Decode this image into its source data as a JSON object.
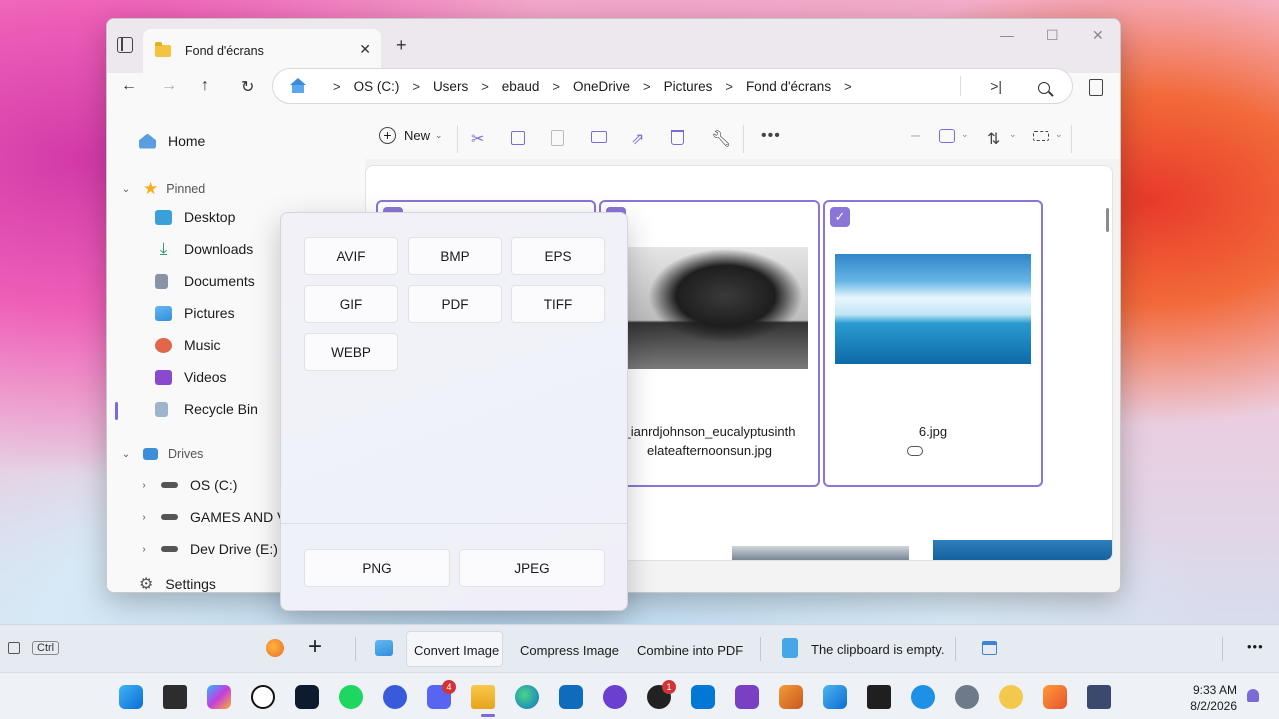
{
  "window": {
    "tab_title": "Fond d'écrans",
    "tab_close": "✕",
    "new_tab": "+",
    "min": "—",
    "max": "☐",
    "close": "✕"
  },
  "nav": {
    "back": "←",
    "forward": "→",
    "up": "↑",
    "refresh": "↻"
  },
  "address": {
    "crumbs": [
      "OS (C:)",
      "Users",
      "ebaud",
      "OneDrive",
      "Pictures",
      "Fond d'écrans"
    ],
    "separator": ">",
    "expand_glyph": ">|"
  },
  "sidebar": {
    "home": "Home",
    "pinned_header": "Pinned",
    "pinned": [
      {
        "label": "Desktop",
        "icon": "desktop-icon",
        "color": "#3aa0d8"
      },
      {
        "label": "Downloads",
        "icon": "download-icon",
        "color": "#2e9e6b"
      },
      {
        "label": "Documents",
        "icon": "documents-icon",
        "color": "#8a93a6"
      },
      {
        "label": "Pictures",
        "icon": "pictures-icon",
        "color": "#2f8fdc"
      },
      {
        "label": "Music",
        "icon": "music-icon",
        "color": "#e2664a"
      },
      {
        "label": "Videos",
        "icon": "videos-icon",
        "color": "#8a4ad0"
      },
      {
        "label": "Recycle Bin",
        "icon": "recycle-bin-icon",
        "color": "#6e8fb0"
      }
    ],
    "drives_header": "Drives",
    "drives": [
      {
        "label": "OS (C:)",
        "icon": "drive-icon"
      },
      {
        "label": "GAMES AND VS",
        "icon": "drive-icon"
      },
      {
        "label": "Dev Drive (E:)",
        "icon": "drive-icon"
      }
    ],
    "settings": "Settings",
    "active_color": "#7c6bd6"
  },
  "commandbar": {
    "new_label": "New",
    "icons": [
      "cut-icon",
      "copy-icon",
      "paste-icon",
      "rename-icon",
      "share-icon",
      "delete-icon",
      "properties-icon",
      "more-icon"
    ],
    "more": "•••"
  },
  "files": [
    {
      "name": "_ianrdjohnson_eucalyptusinthelateafternoonsun.jpg",
      "line1": "_ianrdjohnson_eucalyptusinth",
      "line2": "elateafternoonsun.jpg",
      "selected": true
    },
    {
      "name": "6.jpg",
      "line1": "6.jpg",
      "line2": "",
      "selected": true
    }
  ],
  "popup": {
    "formats": [
      "AVIF",
      "BMP",
      "EPS",
      "GIF",
      "PDF",
      "TIFF",
      "WEBP"
    ],
    "primary": [
      "PNG",
      "JPEG"
    ]
  },
  "powertoys_bar": {
    "ctrl": "Ctrl",
    "actions": [
      "Convert Image",
      "Compress Image",
      "Combine into PDF"
    ],
    "clipboard": "The clipboard is empty.",
    "more": "•••"
  },
  "taskbar": {
    "badges": {
      "discord": "4",
      "github": "1"
    },
    "time": "9:33 AM",
    "date": "8/2/2026"
  },
  "colors": {
    "selection": "#8b75d6",
    "accent": "#7c6bd6"
  }
}
